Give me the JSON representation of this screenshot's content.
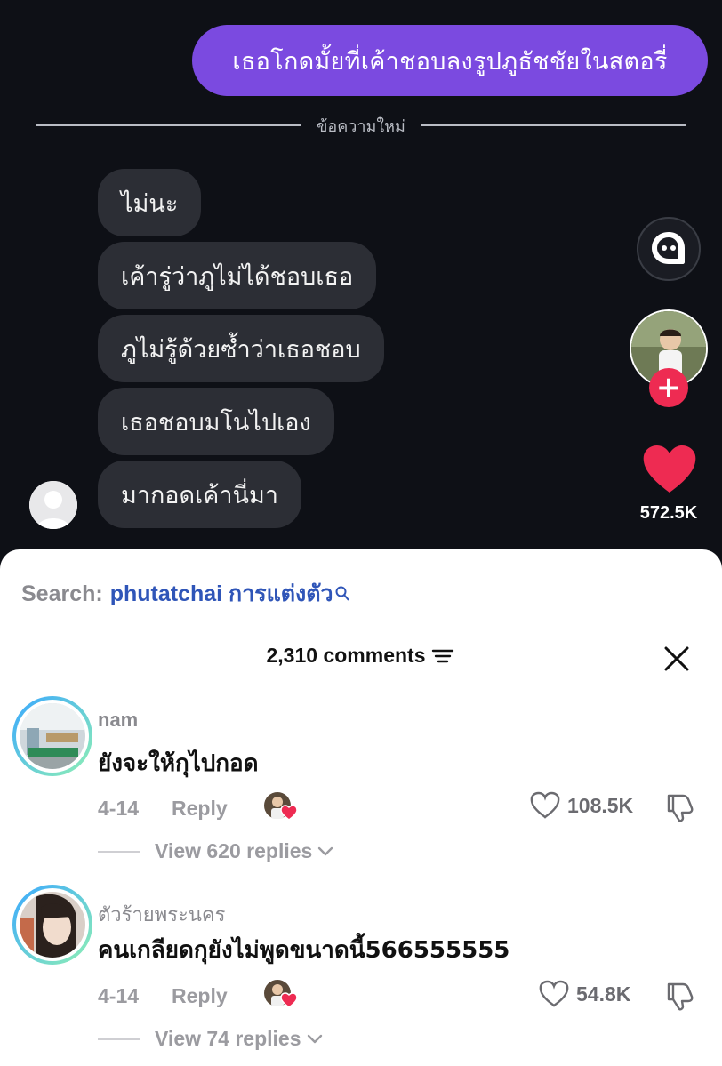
{
  "chat": {
    "sent_message": "เธอโกดมั้ยที่เค้าชอบลงรูปภูธัชชัยในสตอรี่",
    "divider_label": "ข้อความใหม่",
    "received": [
      "ไม่นะ",
      "เค้ารู่ว่าภูไม่ได้ชอบเธอ",
      "ภูไม่รู้ด้วยซ้ำว่าเธอชอบ",
      "เธอชอบมโนไปเอง",
      "มากอดเค้านี่มา"
    ]
  },
  "sidebar": {
    "like_count": "572.5K",
    "follow_icon": "plus-icon",
    "chat_icon": "chat-icon"
  },
  "search": {
    "label": "Search:",
    "term": "phutatchai การแต่งตัว"
  },
  "comments_header": {
    "count_label": "2,310 comments"
  },
  "comments": [
    {
      "username": "nam",
      "text": "ยังจะให้กุไปกอด",
      "date": "4-14",
      "reply_label": "Reply",
      "likes": "108.5K",
      "view_replies": "View 620 replies"
    },
    {
      "username": "ตัวร้ายพระนคร",
      "text": "คนเกลียดกุยังไม่พูดขนาดนี้566555555",
      "date": "4-14",
      "reply_label": "Reply",
      "likes": "54.8K",
      "view_replies": "View 74 replies"
    }
  ],
  "colors": {
    "sent_bubble": "#7b4ae0",
    "received_bubble": "#2c2e35",
    "search_term": "#2f55b8",
    "like_red": "#ee2b52"
  }
}
